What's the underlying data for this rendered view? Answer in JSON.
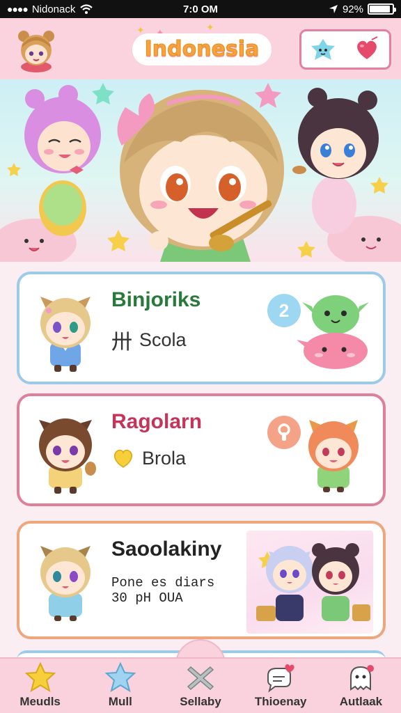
{
  "status": {
    "carrier": "Nidonack",
    "time": "7:0 OM",
    "battery": "92%",
    "battery_level": 0.92
  },
  "header": {
    "title": "Indonesia",
    "avatar_icon": "character-avatar-icon",
    "actions": [
      {
        "icon": "blue-star-mascot-icon"
      },
      {
        "icon": "heart-balloon-icon"
      }
    ]
  },
  "cards": [
    {
      "name": "Binjoriks",
      "sub_glyph": "卅",
      "sub_text": "Scola",
      "badge": "2",
      "badge_color": "#9dd7f2",
      "name_color": "#287a3a"
    },
    {
      "name": "Ragolarn",
      "sub_glyph": "",
      "sub_text": "Brola",
      "badge": "",
      "badge_color": "#f5a387",
      "name_color": "#c7345a",
      "sub_icon": "yellow-heart-icon",
      "badge_icon": "keyhole-icon"
    },
    {
      "name": "Saoolakiny",
      "desc_line1": "Pone es diars",
      "desc_line2": "30 pH OUA"
    }
  ],
  "tabs": [
    {
      "label": "Meudls",
      "icon": "star-icon"
    },
    {
      "label": "Mull",
      "icon": "blue-star-icon"
    },
    {
      "label": "Sellaby",
      "icon": "cross-icon"
    },
    {
      "label": "Thioenay",
      "icon": "chat-heart-icon"
    },
    {
      "label": "Autlaak",
      "icon": "ghost-icon"
    }
  ],
  "colors": {
    "accent_pink": "#e57f9f",
    "header_bg": "#fad3de",
    "title_orange": "#f7a23a"
  }
}
